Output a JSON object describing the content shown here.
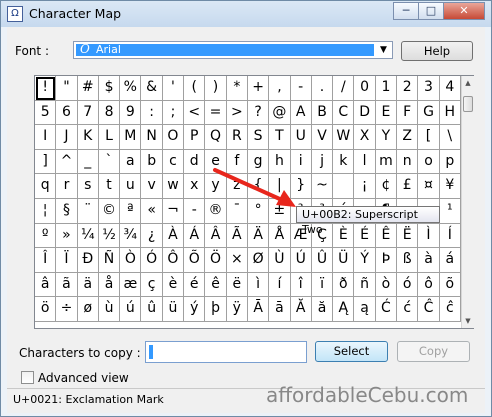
{
  "window": {
    "title": "Character Map",
    "minimize": "─",
    "maximize": "□",
    "close": "✕"
  },
  "font": {
    "label": "Font :",
    "glyph": "O",
    "value": "Arial",
    "help_label": "Help"
  },
  "grid": {
    "rows": [
      [
        "!",
        "\"",
        "#",
        "$",
        "%",
        "&",
        "'",
        "(",
        ")",
        "*",
        "+",
        ",",
        "-",
        ".",
        "/",
        "0",
        "1",
        "2",
        "3",
        "4"
      ],
      [
        "5",
        "6",
        "7",
        "8",
        "9",
        ":",
        ";",
        "<",
        "=",
        ">",
        "?",
        "@",
        "A",
        "B",
        "C",
        "D",
        "E",
        "F",
        "G",
        "H"
      ],
      [
        "I",
        "J",
        "K",
        "L",
        "M",
        "N",
        "O",
        "P",
        "Q",
        "R",
        "S",
        "T",
        "U",
        "V",
        "W",
        "X",
        "Y",
        "Z",
        "[",
        "\\"
      ],
      [
        "]",
        "^",
        "_",
        "`",
        "a",
        "b",
        "c",
        "d",
        "e",
        "f",
        "g",
        "h",
        "i",
        "j",
        "k",
        "l",
        "m",
        "n",
        "o",
        "p"
      ],
      [
        "q",
        "r",
        "s",
        "t",
        "u",
        "v",
        "w",
        "x",
        "y",
        "z",
        "{",
        "|",
        "}",
        "~",
        "",
        "¡",
        "¢",
        "£",
        "¤",
        "¥"
      ],
      [
        "¦",
        "§",
        "¨",
        "©",
        "ª",
        "«",
        "¬",
        "-",
        "®",
        "¯",
        "°",
        "±",
        "²",
        "³",
        "´",
        "µ",
        "¶",
        "·",
        "¸",
        "¹"
      ],
      [
        "º",
        "»",
        "¼",
        "½",
        "¾",
        "¿",
        "À",
        "Á",
        "Â",
        "Ã",
        "Ä",
        "Å",
        "Æ",
        "Ç",
        "È",
        "É",
        "Ê",
        "Ë",
        "Ì",
        "Í"
      ],
      [
        "Î",
        "Ï",
        "Ð",
        "Ñ",
        "Ò",
        "Ó",
        "Ô",
        "Õ",
        "Ö",
        "×",
        "Ø",
        "Ù",
        "Ú",
        "Û",
        "Ü",
        "Ý",
        "Þ",
        "ß",
        "à",
        "á"
      ],
      [
        "â",
        "ã",
        "ä",
        "å",
        "æ",
        "ç",
        "è",
        "é",
        "ê",
        "ë",
        "ì",
        "í",
        "î",
        "ï",
        "ð",
        "ñ",
        "ò",
        "ó",
        "ô",
        "õ"
      ],
      [
        "ö",
        "÷",
        "ø",
        "ù",
        "ú",
        "û",
        "ü",
        "ý",
        "þ",
        "ÿ",
        "Ā",
        "ā",
        "Ă",
        "ă",
        "Ą",
        "ą",
        "Ć",
        "ć",
        "Ĉ",
        "ĉ"
      ]
    ],
    "selected_char": "!"
  },
  "tooltip": "U+00B2: Superscript Two",
  "copy": {
    "label": "Characters to copy :",
    "value": "",
    "select_label": "Select",
    "copy_label": "Copy"
  },
  "advanced": {
    "label": "Advanced view",
    "checked": false
  },
  "status": "U+0021: Exclamation Mark",
  "watermark": "affordableCebu.com",
  "icons": {
    "app": "character-map-icon",
    "scroll_up": "▲",
    "scroll_down": "▼",
    "dropdown": "▼"
  },
  "colors": {
    "selection": "#3399ff",
    "annotation_arrow": "#e8261c"
  }
}
